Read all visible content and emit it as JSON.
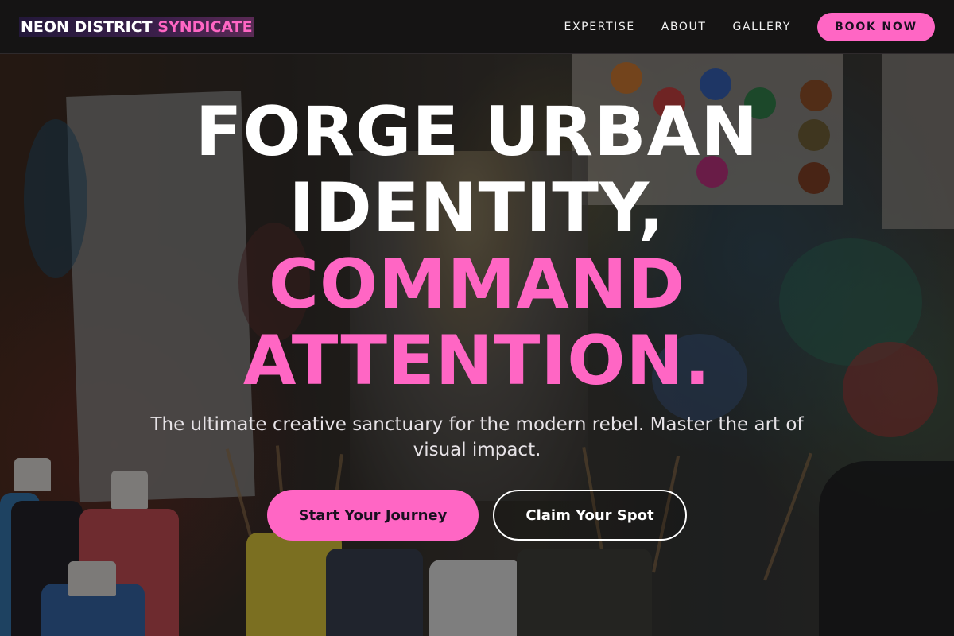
{
  "header": {
    "logo": {
      "part1": "NEON DISTRICT",
      "part2": "SYNDICATE"
    },
    "nav": [
      {
        "label": "EXPERTISE"
      },
      {
        "label": "ABOUT"
      },
      {
        "label": "GALLERY"
      }
    ],
    "cta_label": "BOOK NOW"
  },
  "hero": {
    "headline": {
      "line1": "FORGE URBAN",
      "line2": "IDENTITY,",
      "line3": "COMMAND",
      "line4": "ATTENTION."
    },
    "subtitle": "The ultimate creative sanctuary for the modern rebel. Master the art of visual impact.",
    "primary_cta": "Start Your Journey",
    "secondary_cta": "Claim Your Spot"
  },
  "colors": {
    "accent": "#ff66c4",
    "header_bg": "#151414",
    "text": "#ffffff"
  }
}
